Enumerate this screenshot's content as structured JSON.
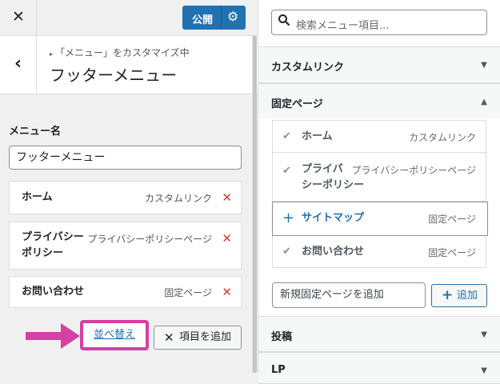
{
  "topbar": {
    "close_icon": "✕",
    "publish_label": "公開",
    "gear_icon": "⚙"
  },
  "header": {
    "back_icon": "‹",
    "breadcrumb": "「メニュー」をカスタマイズ中",
    "title": "フッターメニュー"
  },
  "menu": {
    "name_label": "メニュー名",
    "name_value": "フッターメニュー",
    "items": [
      {
        "title": "ホーム",
        "type": "カスタムリンク"
      },
      {
        "title_line1": "プライバシー",
        "title_line2": "ポリシー",
        "type": "プライバシーポリシーページ"
      },
      {
        "title": "お問い合わせ",
        "type": "固定ページ"
      }
    ],
    "remove_icon": "✕",
    "reorder_label": "並べ替え",
    "add_items_icon": "✕",
    "add_items_label": "項目を追加"
  },
  "right": {
    "search_placeholder": "検索メニュー項目...",
    "sections": [
      {
        "title": "カスタムリンク",
        "expanded": false
      },
      {
        "title": "固定ページ",
        "expanded": true
      },
      {
        "title": "投稿",
        "expanded": false
      },
      {
        "title": "LP",
        "expanded": false
      }
    ],
    "pages": [
      {
        "name": "ホーム",
        "type": "カスタムリンク",
        "icon": "✔"
      },
      {
        "name_line1": "プライバ",
        "name_line2": "シーポリシー",
        "type": "プライバシーポリシーページ",
        "icon": "✔"
      },
      {
        "name": "サイトマップ",
        "type": "固定ページ",
        "icon": "+"
      },
      {
        "name": "お問い合わせ",
        "type": "固定ページ",
        "icon": "✔"
      }
    ],
    "new_page_placeholder": "新規固定ページを追加",
    "add_label": "追加",
    "add_icon": "+"
  },
  "colors": {
    "accent": "#2271b1",
    "danger": "#d63638",
    "highlight": "#d63fa3"
  }
}
